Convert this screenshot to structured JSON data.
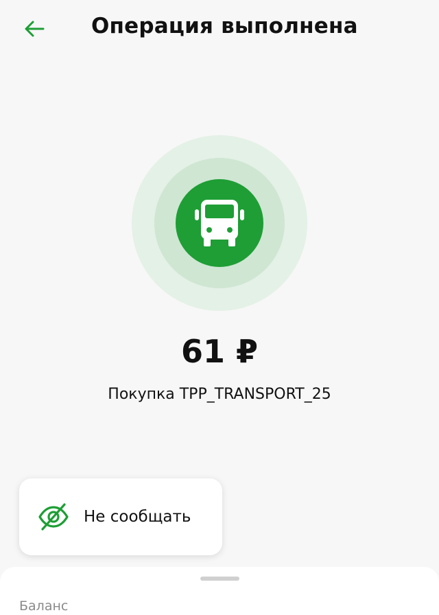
{
  "header": {
    "title": "Операция выполнена",
    "back_icon": "arrow-left-icon"
  },
  "transaction": {
    "icon": "bus-icon",
    "amount": "61 ₽",
    "description": "Покупка TPP_TRANSPORT_25"
  },
  "notify_card": {
    "icon": "eye-crossed-icon",
    "label": "Не сообщать"
  },
  "bottom_sheet": {
    "section_label": "Баланс"
  },
  "colors": {
    "accent": "#1e9e35",
    "ring_mid": "#cfe6d3",
    "ring_outer": "#e4f1e6",
    "background": "#f7f7f7"
  }
}
